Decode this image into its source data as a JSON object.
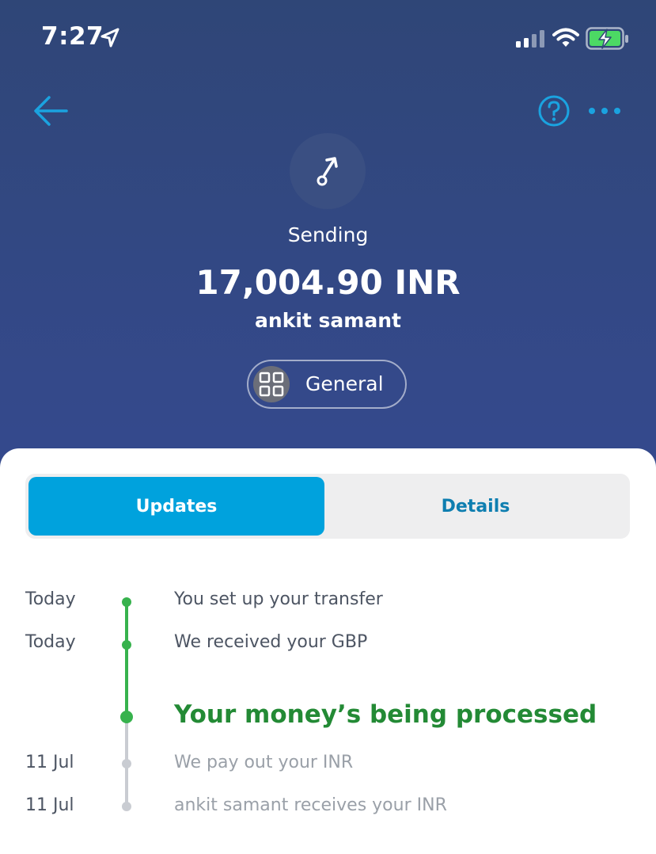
{
  "status_bar": {
    "time": "7:27"
  },
  "icons": {
    "back": "arrow-left-icon",
    "help": "question-circle-icon",
    "more": "more-horizontal-icon",
    "transfer": "send-arrow-icon",
    "category": "grid-icon"
  },
  "colors": {
    "accent": "#00a2dd",
    "success": "#37b24d",
    "success_text": "#238a35",
    "header_bg": "#34498a"
  },
  "header": {
    "status_label": "Sending",
    "amount": "17,004.90 INR",
    "recipient": "ankit samant",
    "category": "General"
  },
  "tabs": [
    {
      "label": "Updates",
      "active": true
    },
    {
      "label": "Details",
      "active": false
    }
  ],
  "timeline": [
    {
      "date": "Today",
      "text": "You set up your transfer",
      "state": "done"
    },
    {
      "date": "Today",
      "text": "We received your GBP",
      "state": "done"
    },
    {
      "date": "",
      "text": "Your money’s being processed",
      "state": "current"
    },
    {
      "date": "11 Jul",
      "text": "We pay out your INR",
      "state": "pending"
    },
    {
      "date": "11 Jul",
      "text": "ankit samant receives your INR",
      "state": "pending"
    }
  ]
}
